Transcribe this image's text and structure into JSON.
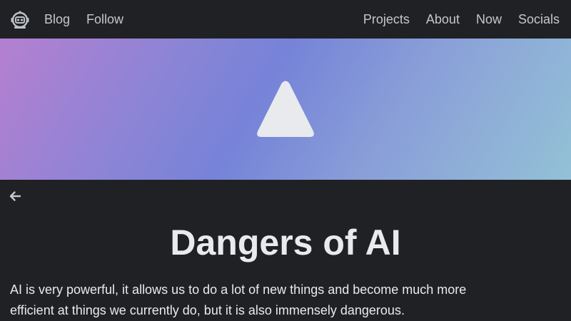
{
  "nav": {
    "logo_icon": "robot-face-icon",
    "left_links": [
      "Blog",
      "Follow"
    ],
    "right_links": [
      "Projects",
      "About",
      "Now",
      "Socials"
    ]
  },
  "hero": {
    "icon": "triangle-icon",
    "gradient_colors": [
      "#b57fd0",
      "#7683d8",
      "#93c1d6"
    ]
  },
  "back": {
    "icon": "arrow-left-icon"
  },
  "post": {
    "title": "Dangers of AI",
    "intro": "AI is very powerful, it allows us to do a lot of new things and become much more efficient at things we currently do, but it is also immensely dangerous."
  },
  "colors": {
    "background": "#202124",
    "text": "#e8eaed",
    "nav_text": "#c4c7cc"
  }
}
